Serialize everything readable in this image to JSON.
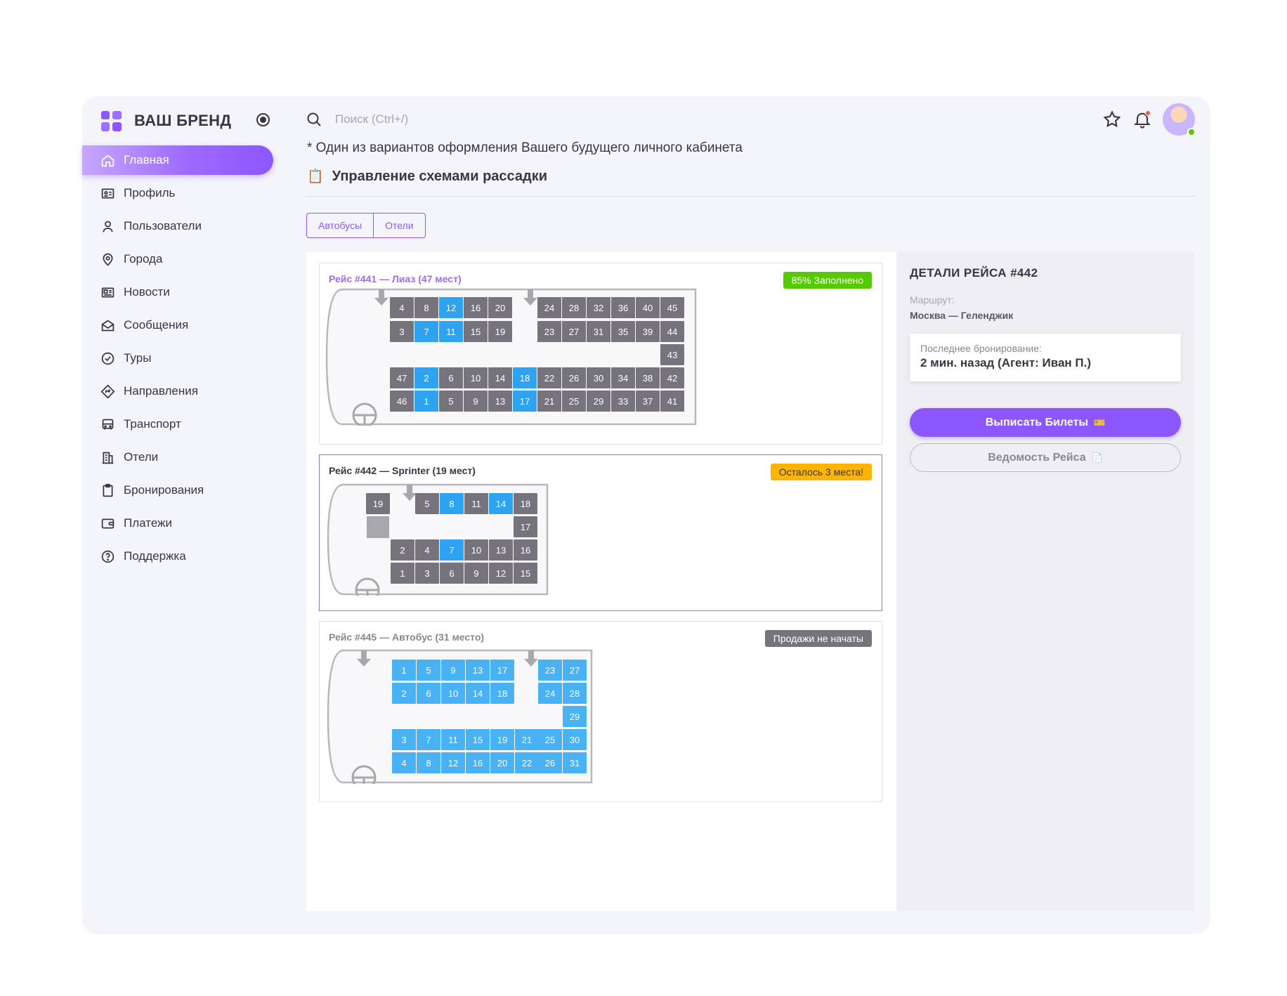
{
  "brand": {
    "name": "ВАШ БРЕНД"
  },
  "search": {
    "placeholder": "Поиск (Ctrl+/)"
  },
  "sidebar": {
    "items": [
      {
        "label": "Главная",
        "icon": "home-icon",
        "active": true
      },
      {
        "label": "Профиль",
        "icon": "id-card-icon"
      },
      {
        "label": "Пользователи",
        "icon": "user-icon"
      },
      {
        "label": "Города",
        "icon": "map-pin-icon"
      },
      {
        "label": "Новости",
        "icon": "news-icon"
      },
      {
        "label": "Сообщения",
        "icon": "mail-open-icon"
      },
      {
        "label": "Туры",
        "icon": "check-circle-icon"
      },
      {
        "label": "Направления",
        "icon": "direction-icon"
      },
      {
        "label": "Транспорт",
        "icon": "bus-icon"
      },
      {
        "label": "Отели",
        "icon": "building-icon"
      },
      {
        "label": "Бронирования",
        "icon": "clipboard-icon"
      },
      {
        "label": "Платежи",
        "icon": "wallet-icon"
      },
      {
        "label": "Поддержка",
        "icon": "help-circle-icon"
      }
    ]
  },
  "header": {
    "notice": "* Один из вариантов оформления Вашего будущего личного кабинета",
    "title": "Управление схемами рассадки",
    "title_emoji": "📋"
  },
  "tabs": [
    "Автобусы",
    "Отели"
  ],
  "colors": {
    "accent": "#8c57ff",
    "seat_taken": "#77737d",
    "seat_free": "#2ea3f2",
    "seat_free_light": "#48b2f5",
    "badge_green": "#56ca00",
    "badge_orange": "#ffb400",
    "badge_gray": "#77737d"
  },
  "trips": [
    {
      "title": "Рейс #441 — Лиаз (47 мест)",
      "badge": "85% Заполнено",
      "badge_color": "#56ca00",
      "badge_text_color": "#ffffff",
      "title_color": "#9e69fd",
      "selected": false,
      "free_seats": [
        "12",
        "7",
        "11",
        "2",
        "18",
        "1",
        "17"
      ]
    },
    {
      "title": "Рейс #442 — Sprinter (19 мест)",
      "badge": "Осталось 3 места!",
      "badge_color": "#ffb400",
      "badge_text_color": "#3a3541",
      "title_color": "#3a3541",
      "selected": true,
      "free_seats": [
        "8",
        "14",
        "7"
      ]
    },
    {
      "title": "Рейс #445 — Автобус (31 место)",
      "badge": "Продажи не начаты",
      "badge_color": "#77737d",
      "badge_text_color": "#ffffff",
      "title_color": "#8a8693",
      "selected": false,
      "free_seats": [
        "all"
      ]
    }
  ],
  "details": {
    "title": "ДЕТАЛИ РЕЙСА #442",
    "route_label": "Маршрут:",
    "route": "Москва — Геленджик",
    "last_booking_label": "Последнее бронирование:",
    "last_booking_value": "2 мин. назад (Агент: Иван П.)",
    "primary_button": "Выписать Билеты",
    "primary_emoji": "🎫",
    "secondary_button": "Ведомость Рейса",
    "secondary_emoji": "📄"
  }
}
